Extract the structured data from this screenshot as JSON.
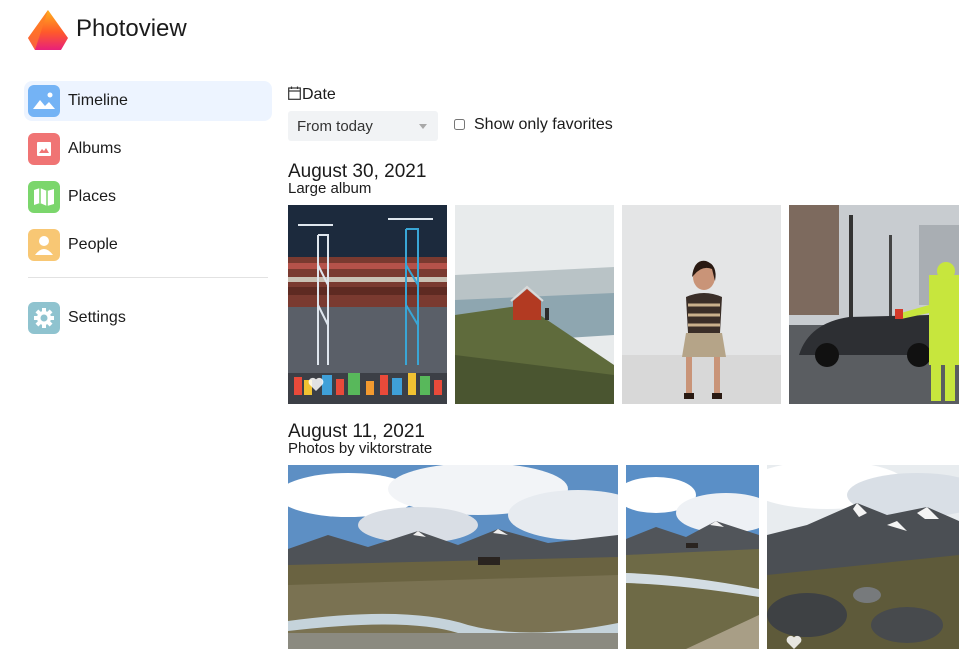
{
  "app": {
    "title": "Photoview"
  },
  "sidebar": {
    "items": [
      {
        "label": "Timeline",
        "icon": "timeline-icon",
        "color": "#74b3f5"
      },
      {
        "label": "Albums",
        "icon": "albums-icon",
        "color": "#f07474"
      },
      {
        "label": "Places",
        "icon": "places-icon",
        "color": "#7bd66c"
      },
      {
        "label": "People",
        "icon": "people-icon",
        "color": "#f8c774"
      }
    ],
    "settings": {
      "label": "Settings",
      "icon": "gear-icon",
      "color": "#8fc3cf"
    }
  },
  "filters": {
    "date_label": "Date",
    "date_value": "From today",
    "favorites_label": "Show only favorites",
    "favorites_checked": false
  },
  "timeline": [
    {
      "date": "August 30, 2021",
      "album": "Large album",
      "photos": [
        "shipping-containers",
        "red-hut-on-hill",
        "woman-sitting",
        "traffic-worker"
      ]
    },
    {
      "date": "August 11, 2021",
      "album": "Photos by viktorstrate",
      "photos": [
        "mountain-valley",
        "mountain-stream",
        "rocky-mountain"
      ]
    }
  ],
  "colors": {
    "accent": "#edf4ff"
  }
}
